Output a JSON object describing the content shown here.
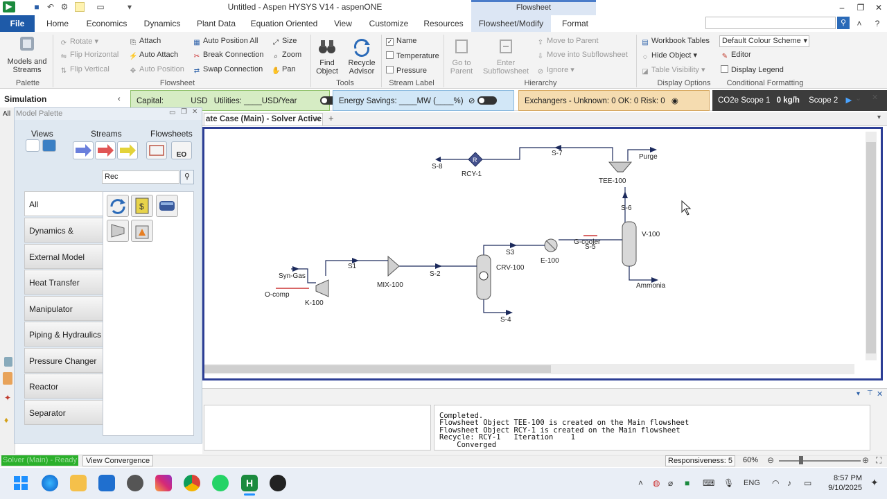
{
  "window": {
    "title": "Untitled - Aspen HYSYS V14 - aspenONE",
    "context_tab_header": "Flowsheet"
  },
  "ribbon_tabs": [
    "File",
    "Home",
    "Economics",
    "Dynamics",
    "Plant Data",
    "Equation Oriented",
    "View",
    "Customize",
    "Resources",
    "Flowsheet/Modify",
    "Format"
  ],
  "ribbon": {
    "palette": {
      "big_label_1": "Models and",
      "big_label_2": "Streams",
      "group": "Palette"
    },
    "flowsheet": {
      "rotate": "Rotate",
      "flip_h": "Flip Horizontal",
      "flip_v": "Flip Vertical",
      "attach": "Attach",
      "auto_attach": "Auto Attach",
      "auto_position": "Auto Position",
      "auto_position_all": "Auto Position All",
      "break_connection": "Break Connection",
      "swap_connection": "Swap Connection",
      "size": "Size",
      "zoom": "Zoom",
      "pan": "Pan",
      "group": "Flowsheet"
    },
    "tools": {
      "find_1": "Find",
      "find_2": "Object",
      "recycle_1": "Recycle",
      "recycle_2": "Advisor",
      "group": "Tools"
    },
    "stream_label": {
      "name": "Name",
      "temperature": "Temperature",
      "pressure": "Pressure",
      "group": "Stream Label"
    },
    "hierarchy": {
      "goto_1": "Go to",
      "goto_2": "Parent",
      "enter_1": "Enter",
      "enter_2": "Subflowsheet",
      "move_parent": "Move to Parent",
      "move_sub": "Move into Subflowsheet",
      "ignore": "Ignore",
      "group": "Hierarchy"
    },
    "display": {
      "workbook_tables": "Workbook Tables",
      "hide_object": "Hide Object",
      "table_visibility": "Table Visibility",
      "colour_scheme": "Default Colour Scheme",
      "editor": "Editor",
      "display_legend": "Display Legend",
      "group": "Display Options",
      "group2": "Conditional Formatting"
    }
  },
  "kpi": {
    "simulation": "Simulation",
    "capital": "Capital:",
    "capital_unit": "USD",
    "utilities": "Utilities: ____USD/Year",
    "energy": "Energy Savings: ____MW   (____%)",
    "exchangers": "Exchangers -   Unknown: 0   OK: 0   Risk: 0",
    "co2_label": "CO2e Scope 1",
    "co2_value": "0 kg/h",
    "scope2": "Scope 2"
  },
  "palette": {
    "title": "Model Palette",
    "views": "Views",
    "streams": "Streams",
    "flowsheets": "Flowsheets",
    "search_value": "Rec",
    "categories": [
      "All",
      "Dynamics & Control",
      "External Model",
      "Heat Transfer",
      "Manipulator",
      "Piping & Hydraulics",
      "Pressure Changer",
      "Reactor",
      "Separator"
    ]
  },
  "doc_tab": {
    "label": "ate Case (Main) - Solver Active"
  },
  "flowsheet_labels": {
    "s8": "S-8",
    "rcy1": "RCY-1",
    "s7": "S-7",
    "purge": "Purge",
    "tee100": "TEE-100",
    "s6": "S-6",
    "v100": "V-100",
    "gcooler": "G-cooler",
    "s5": "S-5",
    "s3": "S3",
    "e100": "E-100",
    "crv100": "CRV-100",
    "ammonia": "Ammonia",
    "syngas": "Syn-Gas",
    "s1": "S1",
    "mx100": "MIX-100",
    "s2": "S-2",
    "ocomp": "O-comp",
    "k100": "K-100",
    "s4": "S-4"
  },
  "trace": {
    "lines": [
      "Completed.",
      "Flowsheet Object TEE-100 is created on the Main flowsheet",
      "Flowsheet Object RCY-1 is created on the Main flowsheet",
      "Recycle: RCY-1   Iteration    1",
      "    Converged"
    ]
  },
  "status": {
    "solver": "Solver (Main) - Ready",
    "view_convergence": "View Convergence",
    "responsiveness": "Responsiveness: 5",
    "zoom": "60%"
  },
  "taskbar": {
    "language": "ENG",
    "time": "8:57 PM",
    "date": "9/10/2025"
  }
}
